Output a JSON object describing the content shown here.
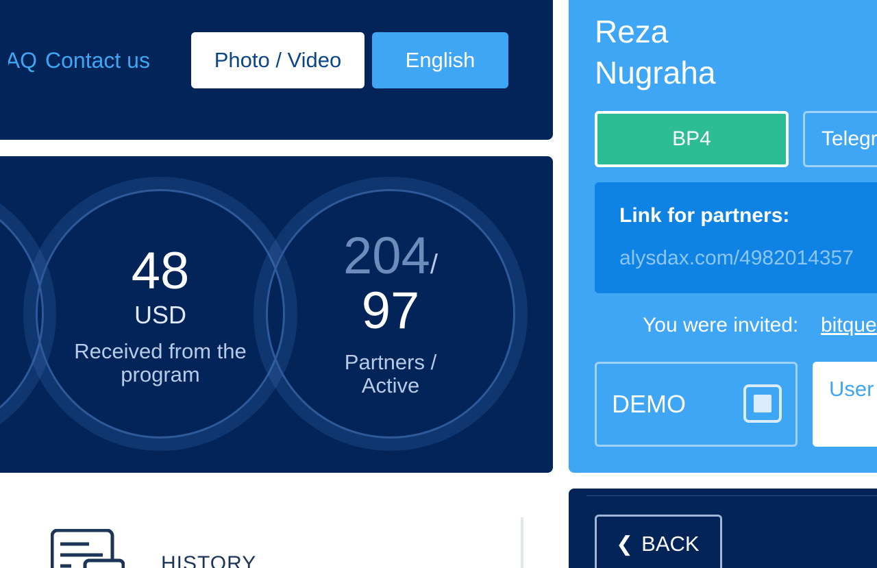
{
  "nav": {
    "faq_label": "FAQ",
    "contact_label": "Contact us",
    "media_button": "Photo / Video",
    "language_button": "English"
  },
  "stats": {
    "received": {
      "value": "48",
      "currency": "USD",
      "label": "Received from the program"
    },
    "partners": {
      "total": "204",
      "separator": "/",
      "active": "97",
      "label": "Partners / Active"
    }
  },
  "history": {
    "label": "HISTORY",
    "icon": "receipt-icon"
  },
  "profile": {
    "name_line1": "Reza",
    "name_line2": "Nugraha",
    "status_button": "BP4",
    "telegram_button": "Telegram",
    "link_title": "Link for partners:",
    "link_url": "alysdax.com/4982014357",
    "invited_label": "You were invited:",
    "invited_by": "bitque",
    "demo_label": "DEMO",
    "support_label": "User Support"
  },
  "back": {
    "label": "BACK",
    "icon": "chevron-left-icon"
  },
  "colors": {
    "navy": "#022459",
    "accent_blue": "#3ea6f5",
    "link_box_blue": "#0f83e4",
    "green": "#2dbd95"
  }
}
